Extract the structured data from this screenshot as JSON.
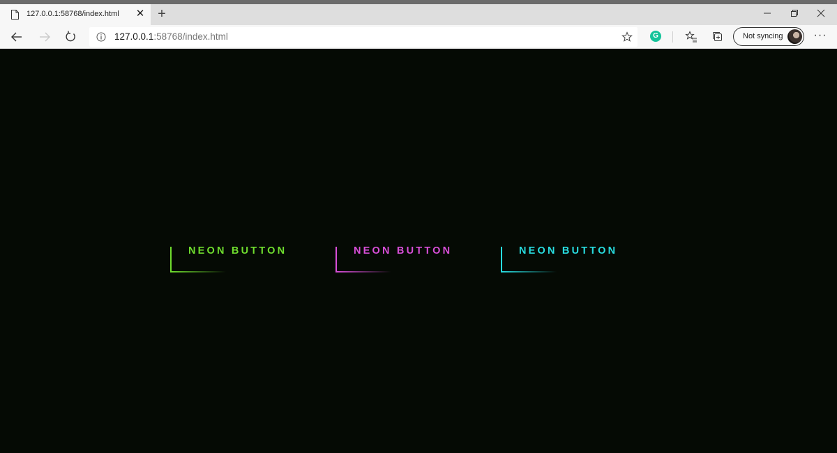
{
  "browser": {
    "tab": {
      "title": "127.0.0.1:58768/index.html",
      "close": "✕",
      "new_tab": "+"
    },
    "address": {
      "host": "127.0.0.1",
      "rest": ":58768/index.html"
    },
    "grammarly": {
      "letter": "G"
    },
    "profile": {
      "label": "Not syncing"
    },
    "more": "···"
  },
  "page": {
    "buttons": [
      {
        "label": "NEON BUTTON",
        "color": "#6fdd2e"
      },
      {
        "label": "NEON BUTTON",
        "color": "#d94fd9"
      },
      {
        "label": "NEON BUTTON",
        "color": "#28dde0"
      }
    ]
  }
}
